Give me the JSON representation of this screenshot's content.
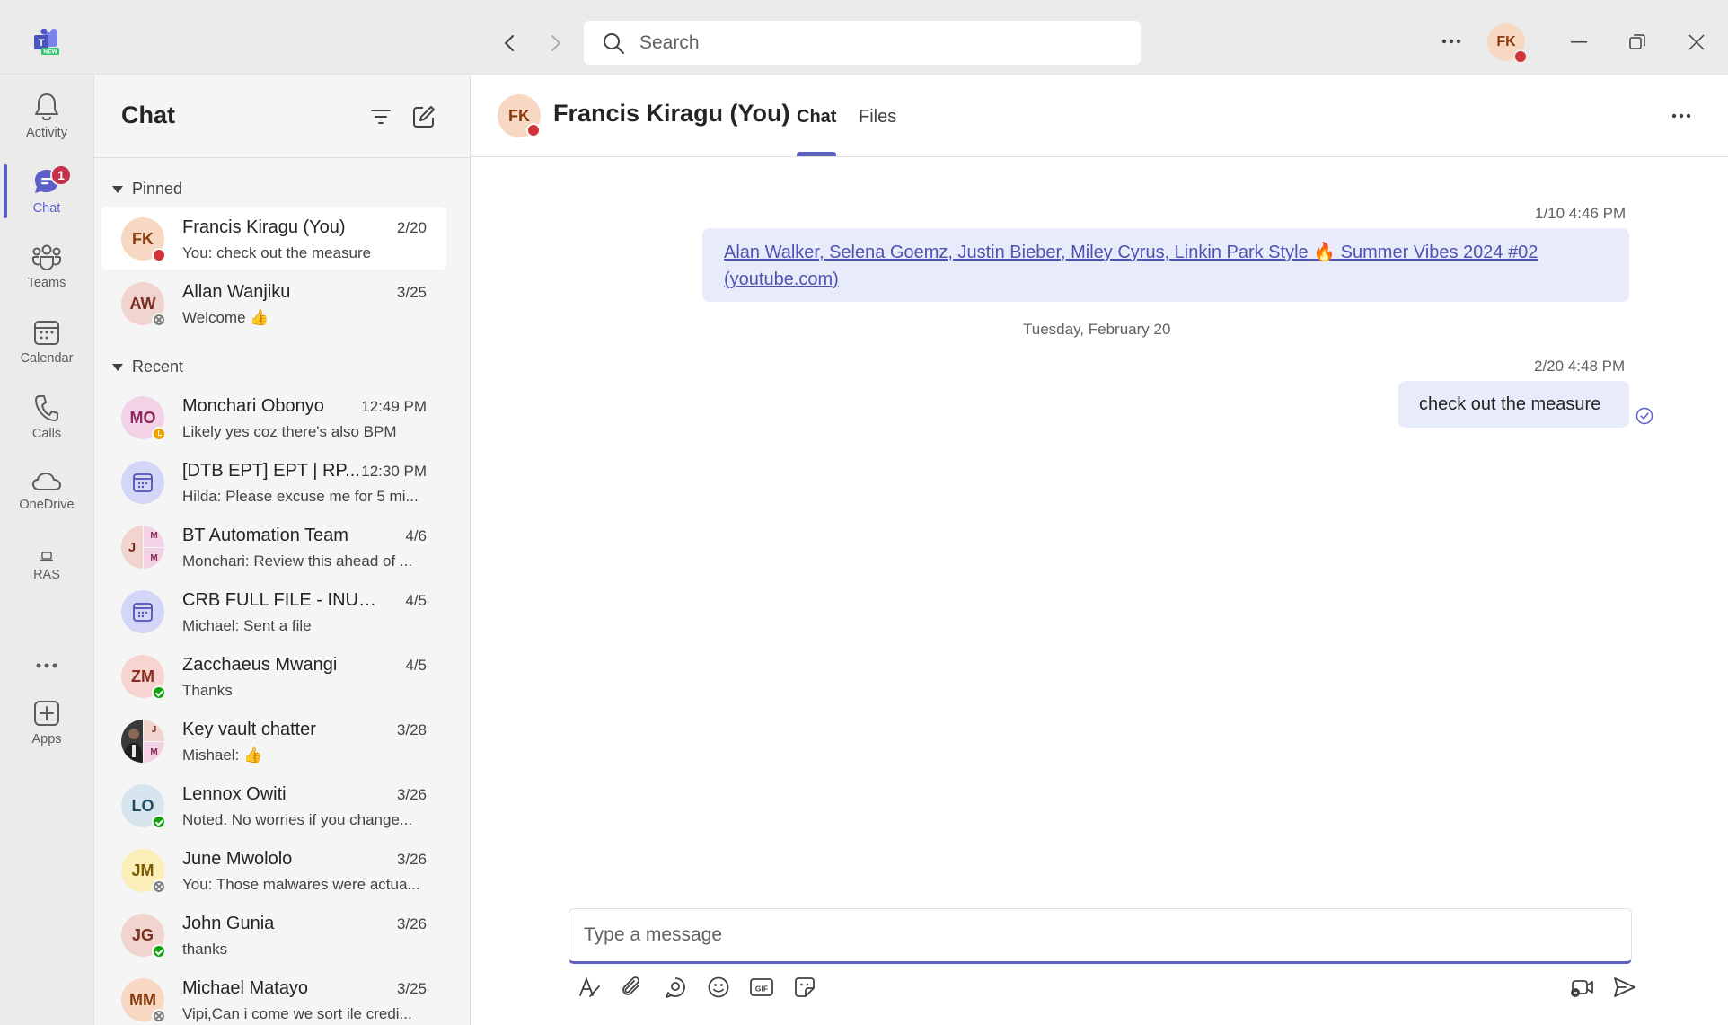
{
  "titlebar": {
    "logo_badge": "NEW",
    "search_placeholder": "Search",
    "user_initials": "FK"
  },
  "rail": {
    "items": [
      {
        "label": "Activity",
        "icon": "bell-icon"
      },
      {
        "label": "Chat",
        "icon": "chat-icon",
        "badge": "1"
      },
      {
        "label": "Teams",
        "icon": "teams-icon"
      },
      {
        "label": "Calendar",
        "icon": "calendar-icon"
      },
      {
        "label": "Calls",
        "icon": "phone-icon"
      },
      {
        "label": "OneDrive",
        "icon": "cloud-icon"
      },
      {
        "label": "RAS",
        "icon": "laptop-icon"
      },
      {
        "label": "",
        "icon": "more-icon"
      },
      {
        "label": "Apps",
        "icon": "add-apps-icon"
      }
    ]
  },
  "chatlist": {
    "title": "Chat",
    "pinned_label": "Pinned",
    "recent_label": "Recent",
    "pinned": [
      {
        "initials": "FK",
        "name": "Francis Kiragu (You)",
        "date": "2/20",
        "preview": "You: check out the measure",
        "presence": "busy"
      },
      {
        "initials": "AW",
        "name": "Allan Wanjiku",
        "date": "3/25",
        "preview": "Welcome 👍",
        "presence": "offline"
      }
    ],
    "recent": [
      {
        "initials": "MO",
        "name": "Monchari Obonyo",
        "date": "12:49 PM",
        "preview": "Likely yes coz there's also BPM",
        "presence": "away"
      },
      {
        "initials": "",
        "name": "[DTB EPT] EPT | RP...",
        "date": "12:30 PM",
        "preview": "Hilda: Please excuse me for 5 mi...",
        "presence": "meeting"
      },
      {
        "initials": "J",
        "name": "BT Automation Team",
        "date": "4/6",
        "preview": "Monchari: Review this ahead of ...",
        "presence": "group"
      },
      {
        "initials": "",
        "name": "CRB FULL FILE - INUA ...",
        "date": "4/5",
        "preview": "Michael: Sent a file",
        "presence": "meeting"
      },
      {
        "initials": "ZM",
        "name": "Zacchaeus Mwangi",
        "date": "4/5",
        "preview": "Thanks",
        "presence": "available"
      },
      {
        "initials": "",
        "name": "Key vault chatter",
        "date": "3/28",
        "preview": "Mishael: 👍",
        "presence": "group-photo"
      },
      {
        "initials": "LO",
        "name": "Lennox Owiti",
        "date": "3/26",
        "preview": "Noted. No worries if you change...",
        "presence": "available"
      },
      {
        "initials": "JM",
        "name": "June Mwololo",
        "date": "3/26",
        "preview": "You: Those malwares were actua...",
        "presence": "offline"
      },
      {
        "initials": "JG",
        "name": "John Gunia",
        "date": "3/26",
        "preview": "thanks",
        "presence": "available"
      },
      {
        "initials": "MM",
        "name": "Michael Matayo",
        "date": "3/25",
        "preview": "Vipi,Can i come we sort ile credi...",
        "presence": "offline"
      }
    ]
  },
  "conversation": {
    "initials": "FK",
    "name": "Francis Kiragu (You)",
    "tabs": [
      "Chat",
      "Files"
    ],
    "messages": [
      {
        "time": "1/10 4:46 PM",
        "text_part1": "Alan Walker, Selena Goemz, Justin Bieber, Miley Cyrus, Linkin Park Style ",
        "emoji": "🔥",
        "text_part2": " Summer Vibes 2024 #02",
        "text_line2": "(youtube.com)"
      },
      {
        "time": "2/20 4:48 PM",
        "text": "check out the measure"
      }
    ],
    "day_separator": "Tuesday, February 20",
    "composer_placeholder": "Type a message",
    "group_avatar_letters": [
      "M",
      "M",
      "J",
      "M"
    ]
  },
  "colors": {
    "accent": "#5b5fc7",
    "busy": "#d13438",
    "available": "#13a10e",
    "away": "#eaa300",
    "badge": "#c4314b"
  }
}
